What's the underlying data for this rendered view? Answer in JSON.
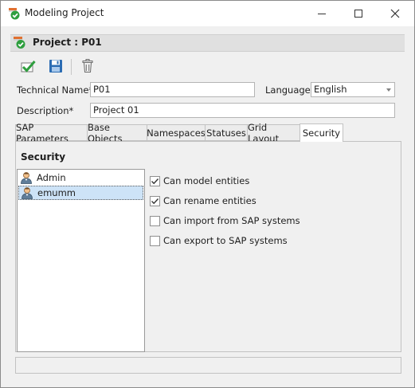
{
  "window": {
    "title": "Modeling Project",
    "app_icon": "checkmark-document-icon",
    "controls": [
      "minimize-icon",
      "maximize-icon",
      "close-icon"
    ]
  },
  "header": {
    "title": "Project : P01",
    "icon": "project-check-icon"
  },
  "toolbar": {
    "buttons": [
      "save-and-close-icon",
      "save-icon",
      "delete-icon"
    ]
  },
  "form": {
    "technical_name_label": "Technical Name*",
    "technical_name_value": "P01",
    "language_label": "Language*",
    "language_value": "English",
    "description_label": "Description*",
    "description_value": "Project 01"
  },
  "tabs": [
    {
      "label": "SAP Parameters",
      "active": false
    },
    {
      "label": "Base Objects",
      "active": false
    },
    {
      "label": "Namespaces",
      "active": false
    },
    {
      "label": "Statuses",
      "active": false
    },
    {
      "label": "Grid Layout",
      "active": false
    },
    {
      "label": "Security",
      "active": true
    }
  ],
  "security": {
    "title": "Security",
    "users": [
      {
        "name": "Admin",
        "icon": "user-icon",
        "selected": false
      },
      {
        "name": "emumm",
        "icon": "user-icon",
        "selected": true
      }
    ],
    "permissions": [
      {
        "label": "Can model entities",
        "checked": true
      },
      {
        "label": "Can rename entities",
        "checked": true
      },
      {
        "label": "Can import from SAP systems",
        "checked": false
      },
      {
        "label": "Can export to SAP systems",
        "checked": false
      }
    ]
  },
  "colors": {
    "selection": "#cde3f7",
    "check_green": "#2e9e3e",
    "save_blue": "#2b6cb3"
  }
}
